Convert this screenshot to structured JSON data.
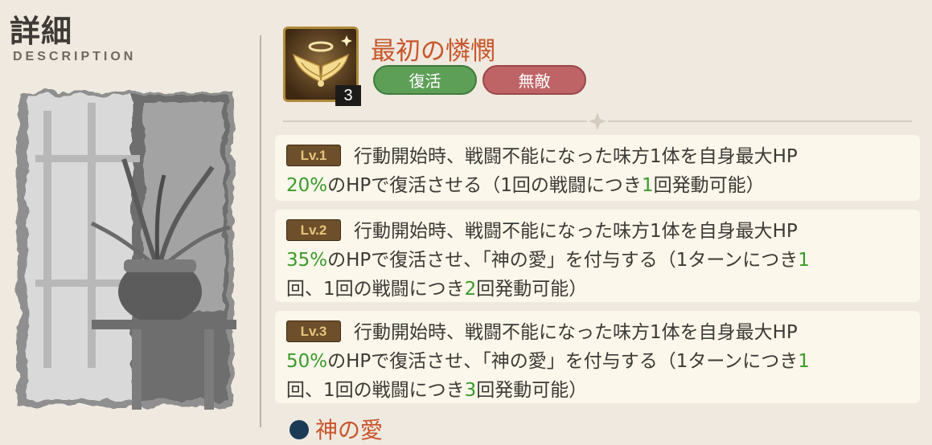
{
  "header": {
    "title": "詳細",
    "subtitle": "DESCRIPTION"
  },
  "skill": {
    "name": "最初の憐憫",
    "icon": "angel-wings-icon",
    "level_badge": "3",
    "tags": [
      "復活",
      "無敵"
    ]
  },
  "levels": [
    {
      "badge": "Lv.1",
      "line1": "行動開始時、戦闘不能になった味方1体を自身最大HP",
      "pct": "20%",
      "rest": "のHPで復活させる（1回の戦闘につき",
      "num1": "1",
      "tail": "回発動可能）"
    },
    {
      "badge": "Lv.2",
      "line1": "行動開始時、戦闘不能になった味方1体を自身最大HP",
      "pct": "35%",
      "rest": "のHPで復活させ、「神の愛」を付与する（1ターンにつき",
      "num1": "1",
      "line3a": "回、1回の戦闘につき",
      "num2": "2",
      "tail": "回発動可能）"
    },
    {
      "badge": "Lv.3",
      "line1": "行動開始時、戦闘不能になった味方1体を自身最大HP",
      "pct": "50%",
      "rest": "のHPで復活させ、「神の愛」を付与する（1ターンにつき",
      "num1": "1",
      "line3a": "回、1回の戦闘につき",
      "num2": "3",
      "tail": "回発動可能）"
    }
  ],
  "next_section": {
    "title": "神の愛",
    "icon": "buff-icon"
  },
  "colors": {
    "accent": "#c8562c",
    "highlight": "#3b9a2a",
    "tag_green": "#5e9f58",
    "tag_red": "#bf6466",
    "background": "#efe9df"
  }
}
